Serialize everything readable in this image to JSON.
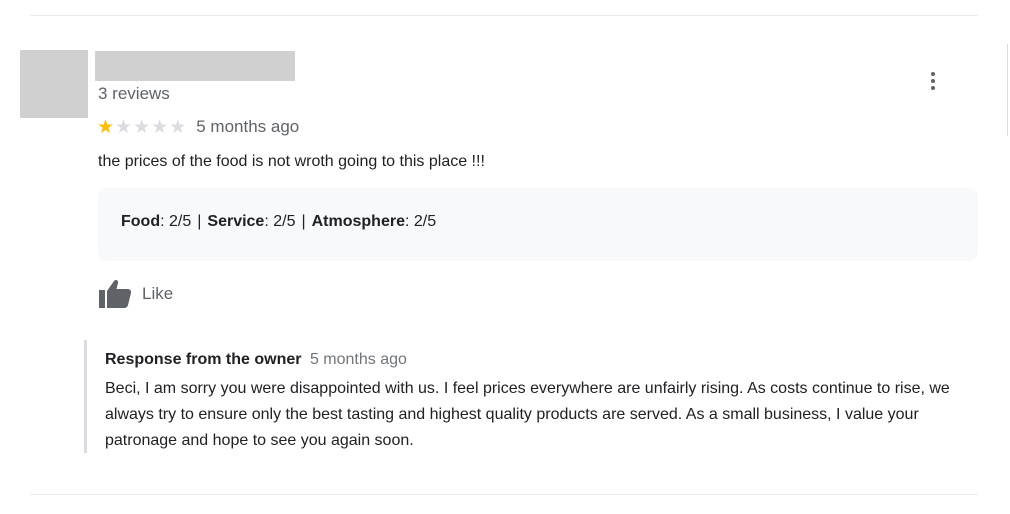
{
  "review": {
    "review_count": "3 reviews",
    "rating": 1,
    "rating_max": 5,
    "time": "5 months ago",
    "text": "the prices of the food is not wroth going to this place !!!",
    "attributes": [
      {
        "label": "Food",
        "value": ": 2/5"
      },
      {
        "label": "Service",
        "value": ": 2/5"
      },
      {
        "label": "Atmosphere",
        "value": ": 2/5"
      }
    ],
    "attribute_separator": "|",
    "like_label": "Like"
  },
  "owner_response": {
    "title": "Response from the owner",
    "time": "5 months ago",
    "text": "Beci, I am sorry you were disappointed with us. I feel prices everywhere are unfairly rising. As costs continue to rise, we always try to ensure only the best tasting and highest quality products are served. As a small business, I value your patronage and hope to see you again soon."
  },
  "icons": {
    "more": "more-vert-icon",
    "like": "thumbs-up-icon",
    "star": "star-icon"
  },
  "colors": {
    "star_filled": "#fbbc04",
    "star_empty": "#dadce0",
    "secondary_text": "#5f6368"
  }
}
